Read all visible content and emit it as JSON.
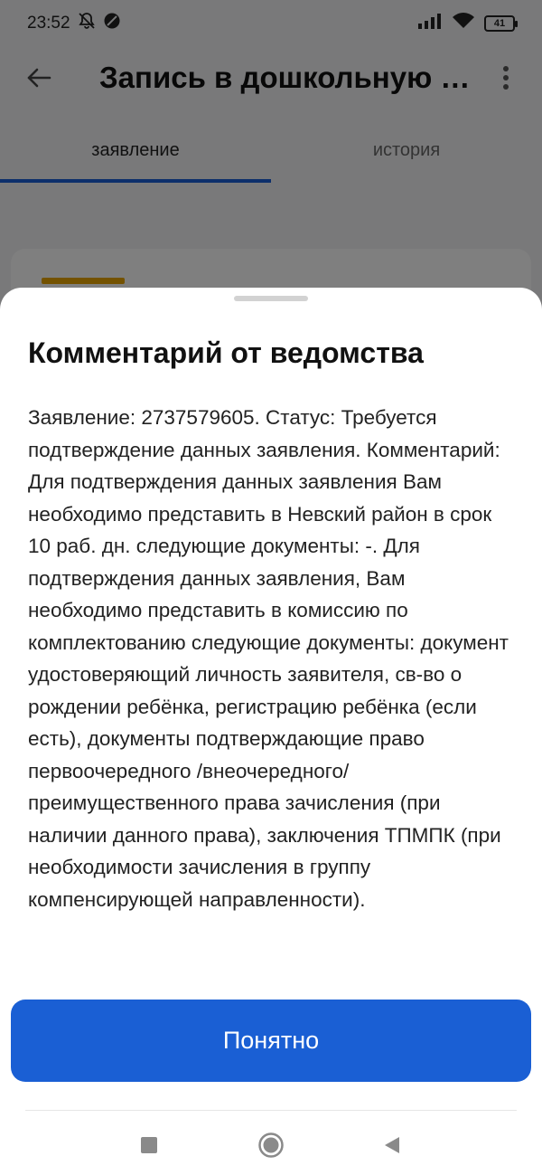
{
  "status_bar": {
    "time": "23:52",
    "battery": "41",
    "icons": [
      "mute-bell-icon",
      "no-disturb-icon",
      "signal-icon",
      "wifi-icon",
      "battery-icon"
    ]
  },
  "app_bar": {
    "title": "Запись в дошкольную организацию",
    "back_icon": "arrow-left-icon",
    "menu_icon": "more-vert-icon"
  },
  "tabs": [
    {
      "label": "заявление",
      "active": true
    },
    {
      "label": "история",
      "active": false
    }
  ],
  "sheet": {
    "title": "Комментарий от ведомства",
    "body": "Заявление: 2737579605. Статус: Требуется подтверждение данных заявления. Комментарий: Для подтверждения данных заявления Вам необходимо представить в Невский район в срок 10 раб. дн. следующие документы: -. Для подтверждения данных заявления, Вам необходимо представить в комиссию по комплектованию следующие документы: документ удостоверяющий личность заявителя, св-во о рождении ребёнка, регистрацию ребёнка (если есть), документы подтверждающие право первоочередного /внеочередного/ преимущественного права зачисления (при наличии данного права), заключения ТПМПК (при необходимости зачисления в группу компенсирующей направленности).",
    "button_label": "Понятно"
  },
  "colors": {
    "accent": "#1a5fd4",
    "badge": "#e8a400",
    "scrim": "rgba(0,0,0,0.5)"
  },
  "nav": [
    "recents-icon",
    "home-icon",
    "back-triangle-icon"
  ]
}
